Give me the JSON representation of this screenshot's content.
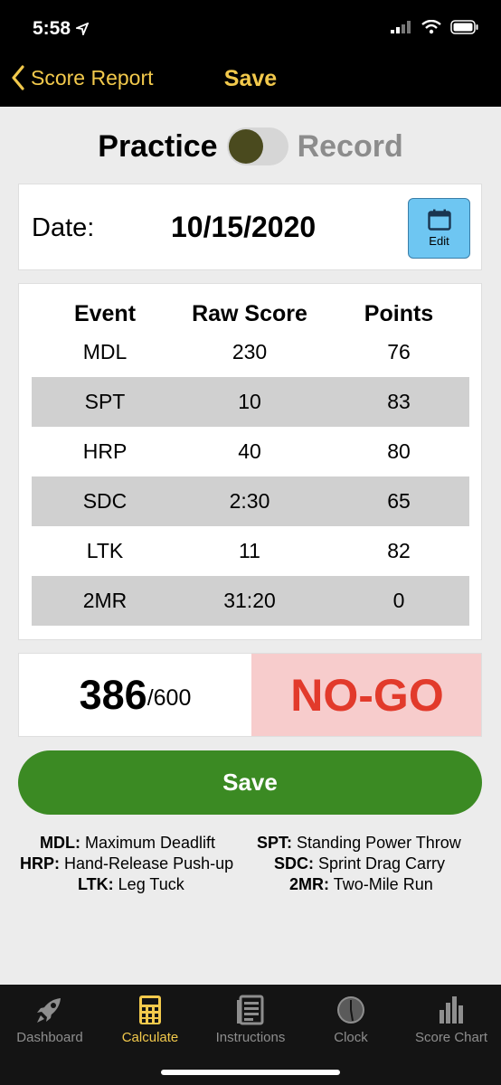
{
  "status": {
    "time": "5:58"
  },
  "nav": {
    "back_label": "Score Report",
    "title": "Save"
  },
  "mode": {
    "left_label": "Practice",
    "right_label": "Record"
  },
  "date": {
    "label": "Date:",
    "value": "10/15/2020",
    "edit_label": "Edit"
  },
  "table": {
    "headers": [
      "Event",
      "Raw Score",
      "Points"
    ],
    "rows": [
      [
        "MDL",
        "230",
        "76"
      ],
      [
        "SPT",
        "10",
        "83"
      ],
      [
        "HRP",
        "40",
        "80"
      ],
      [
        "SDC",
        "2:30",
        "65"
      ],
      [
        "LTK",
        "11",
        "82"
      ],
      [
        "2MR",
        "31:20",
        "0"
      ]
    ]
  },
  "total": {
    "score": "386",
    "max": "/600",
    "result": "NO-GO"
  },
  "save_label": "Save",
  "legend": [
    {
      "abbr": "MDL:",
      "name": "Maximum Deadlift"
    },
    {
      "abbr": "SPT:",
      "name": "Standing Power Throw"
    },
    {
      "abbr": "HRP:",
      "name": "Hand-Release Push-up"
    },
    {
      "abbr": "SDC:",
      "name": "Sprint Drag Carry"
    },
    {
      "abbr": "LTK:",
      "name": "Leg Tuck"
    },
    {
      "abbr": "2MR:",
      "name": "Two-Mile Run"
    }
  ],
  "tabs": [
    {
      "label": "Dashboard",
      "icon": "rocket-icon"
    },
    {
      "label": "Calculate",
      "icon": "calculator-icon"
    },
    {
      "label": "Instructions",
      "icon": "document-icon"
    },
    {
      "label": "Clock",
      "icon": "clock-icon"
    },
    {
      "label": "Score Chart",
      "icon": "bar-chart-icon"
    }
  ],
  "colors": {
    "accent": "#f2c94c",
    "save_green": "#3b8a23",
    "nogo_red": "#e23a2b",
    "nogo_bg": "#f7cccc",
    "edit_blue": "#6ec6f2"
  }
}
